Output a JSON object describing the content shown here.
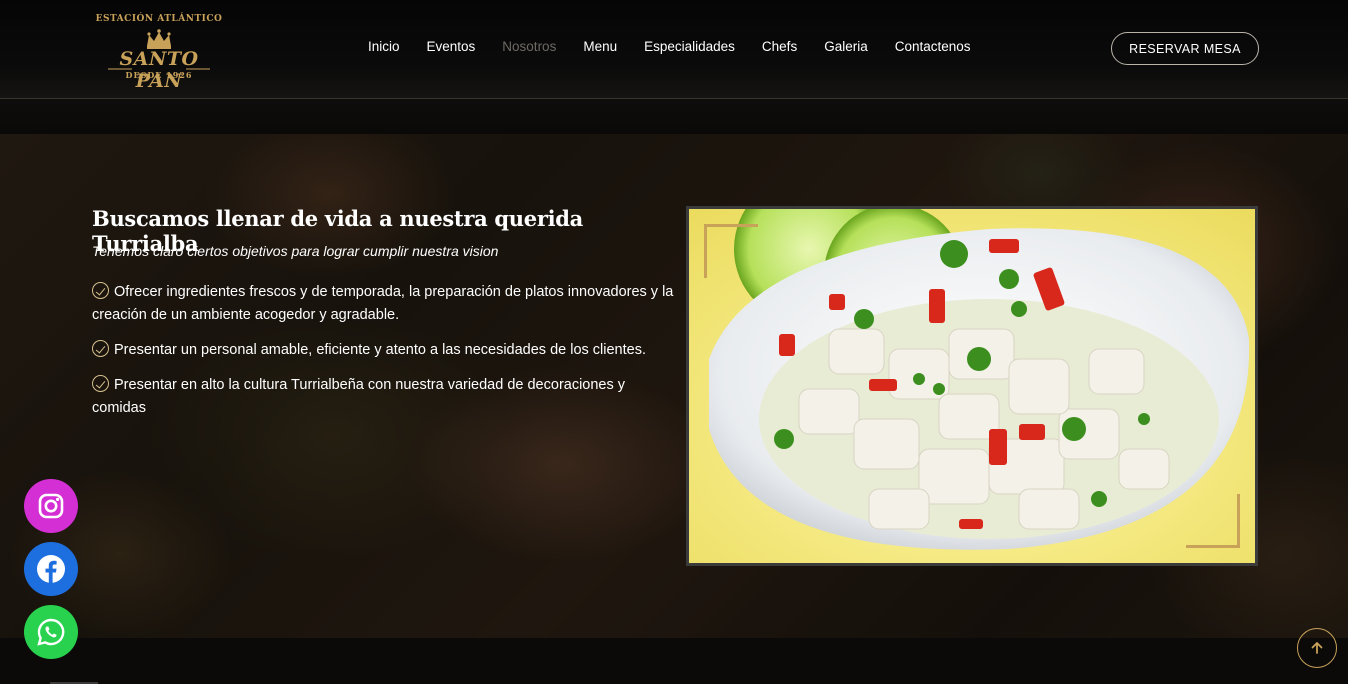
{
  "brand": {
    "arc_text": "ESTACIÓN ATLÁNTICO",
    "name": "SANTO PAN",
    "since": "DESDE 1926"
  },
  "nav": {
    "items": [
      {
        "label": "Inicio"
      },
      {
        "label": "Eventos"
      },
      {
        "label": "Nosotros",
        "active": true
      },
      {
        "label": "Menu"
      },
      {
        "label": "Especialidades"
      },
      {
        "label": "Chefs"
      },
      {
        "label": "Galeria"
      },
      {
        "label": "Contactenos"
      }
    ],
    "reserve_label": "RESERVAR MESA"
  },
  "about": {
    "title": "Buscamos llenar de vida a nuestra querida Turrialba",
    "subtitle": "Tenemos claro ciertos objetivos para lograr cumplir nuestra vision",
    "objectives": [
      "Ofrecer ingredientes frescos y de temporada, la preparación de platos innovadores y la creación de un ambiente acogedor y agradable.",
      "Presentar un personal amable, eficiente y atento a las necesidades de los clientes.",
      "Presentar en alto la cultura Turrialbeña con nuestra variedad de decoraciones y comidas"
    ]
  },
  "social": {
    "instagram_icon": "instagram-icon",
    "facebook_icon": "facebook-icon",
    "whatsapp_icon": "whatsapp-icon"
  },
  "colors": {
    "accent_gold": "#c9a25a",
    "instagram": "#d42fd4",
    "facebook": "#1d6fe0",
    "whatsapp": "#28d24f"
  }
}
